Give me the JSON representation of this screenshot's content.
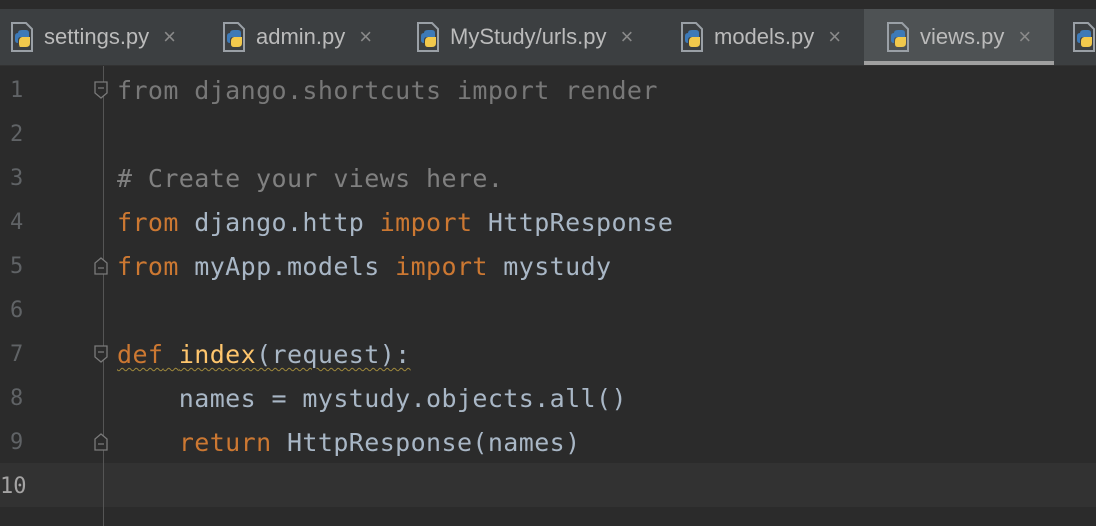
{
  "tabs": [
    {
      "label": "settings.py",
      "close": "×",
      "icon": "python-file-icon",
      "active": false
    },
    {
      "label": "admin.py",
      "close": "×",
      "icon": "python-file-icon",
      "active": false
    },
    {
      "label": "MyStudy/urls.py",
      "close": "×",
      "icon": "python-file-icon",
      "active": false
    },
    {
      "label": "models.py",
      "close": "×",
      "icon": "python-file-icon",
      "active": false
    },
    {
      "label": "views.py",
      "close": "×",
      "icon": "python-file-icon",
      "active": true
    }
  ],
  "editor": {
    "current_line": 10,
    "lines": [
      {
        "num": "1",
        "parts": [
          [
            "from",
            "dim"
          ],
          [
            " django.shortcuts ",
            "dim"
          ],
          [
            "import",
            "dim"
          ],
          [
            " render",
            "dim"
          ]
        ]
      },
      {
        "num": "2",
        "parts": []
      },
      {
        "num": "3",
        "parts": [
          [
            "# Create your views here.",
            "cm"
          ]
        ]
      },
      {
        "num": "4",
        "parts": [
          [
            "from",
            "kw"
          ],
          [
            " django.http ",
            ""
          ],
          [
            "import",
            "kw"
          ],
          [
            " HttpResponse",
            ""
          ]
        ]
      },
      {
        "num": "5",
        "parts": [
          [
            "from",
            "kw"
          ],
          [
            " myApp.models ",
            ""
          ],
          [
            "import",
            "kw"
          ],
          [
            " mystudy",
            ""
          ]
        ]
      },
      {
        "num": "6",
        "parts": []
      },
      {
        "num": "7",
        "parts": [
          [
            "def",
            "kw"
          ],
          [
            " ",
            ""
          ],
          [
            "index",
            "fn"
          ],
          [
            "(request):",
            ""
          ]
        ]
      },
      {
        "num": "8",
        "parts": [
          [
            "    names = mystudy.objects.all()",
            ""
          ]
        ]
      },
      {
        "num": "9",
        "parts": [
          [
            "    ",
            ""
          ],
          [
            "return",
            "kw"
          ],
          [
            " HttpResponse(names)",
            ""
          ]
        ]
      },
      {
        "num": "10",
        "parts": []
      }
    ]
  },
  "colors": {
    "background": "#2b2b2b",
    "keyword": "#cc7832",
    "comment": "#808080",
    "function": "#ffc66d",
    "text": "#a9b7c6"
  }
}
